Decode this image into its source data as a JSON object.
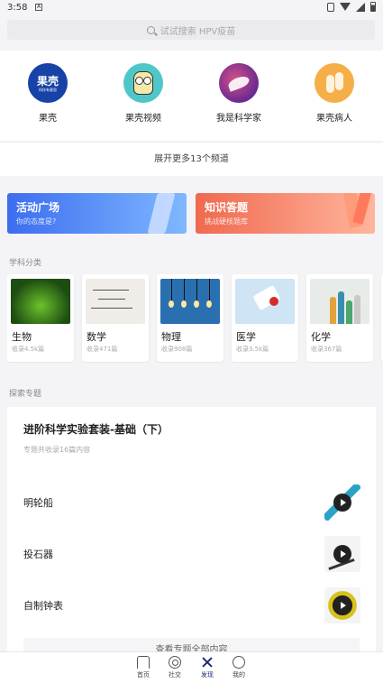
{
  "status_bar": {
    "time": "3:58",
    "app_badge": "A"
  },
  "search": {
    "placeholder": "试试搜索 HPV疫苗"
  },
  "channels": [
    {
      "label": "果壳",
      "logo_text": "果壳",
      "logo_subtext": "科技有意思"
    },
    {
      "label": "果壳视频"
    },
    {
      "label": "我是科学家"
    },
    {
      "label": "果壳病人"
    }
  ],
  "expand_label": "展开更多13个频道",
  "banners": [
    {
      "title": "活动广场",
      "subtitle": "你的态度是?",
      "color": "#3c6df0"
    },
    {
      "title": "知识答题",
      "subtitle": "挑战硬核题库",
      "color": "#f0694f"
    }
  ],
  "categories_title": "学科分类",
  "categories": [
    {
      "name": "生物",
      "count": "收录4.5k篇"
    },
    {
      "name": "数学",
      "count": "收录471篇"
    },
    {
      "name": "物理",
      "count": "收录908篇"
    },
    {
      "name": "医学",
      "count": "收录3.5k篇"
    },
    {
      "name": "化学",
      "count": "收录367篇"
    }
  ],
  "topics_title": "探索专题",
  "topic": {
    "title": "进阶科学实验套装-基础（下）",
    "subtitle": "专题共收录16篇内容",
    "items": [
      {
        "label": "明轮船"
      },
      {
        "label": "投石器"
      },
      {
        "label": "自制钟表"
      }
    ],
    "more_label": "查看专题全部内容"
  },
  "tabs": [
    {
      "label": "首页",
      "icon": "home-icon"
    },
    {
      "label": "社交",
      "icon": "social-icon"
    },
    {
      "label": "发现",
      "icon": "discover-icon",
      "active": true
    },
    {
      "label": "我的",
      "icon": "me-icon"
    }
  ]
}
